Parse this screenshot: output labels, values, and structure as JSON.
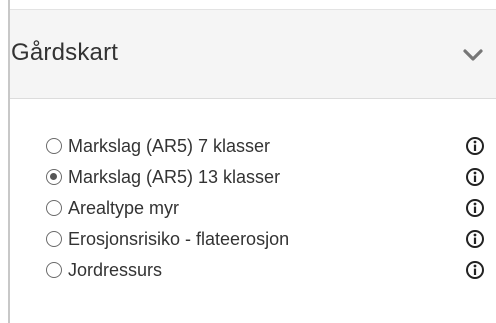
{
  "panel": {
    "title": "Gårdskart",
    "collapse_icon": "chevron-down-icon"
  },
  "layers": [
    {
      "label": "Markslag (AR5) 7 klasser",
      "checked": false,
      "info_icon": "info-icon"
    },
    {
      "label": "Markslag (AR5) 13 klasser",
      "checked": true,
      "info_icon": "info-icon"
    },
    {
      "label": "Arealtype myr",
      "checked": false,
      "info_icon": "info-icon"
    },
    {
      "label": "Erosjonsrisiko - flateerosjon",
      "checked": false,
      "info_icon": "info-icon"
    },
    {
      "label": "Jordressurs",
      "checked": false,
      "info_icon": "info-icon"
    }
  ],
  "colors": {
    "header_background": "#f5f5f5",
    "text": "#333333",
    "icon": "#222222",
    "border": "#c8c8c8"
  }
}
